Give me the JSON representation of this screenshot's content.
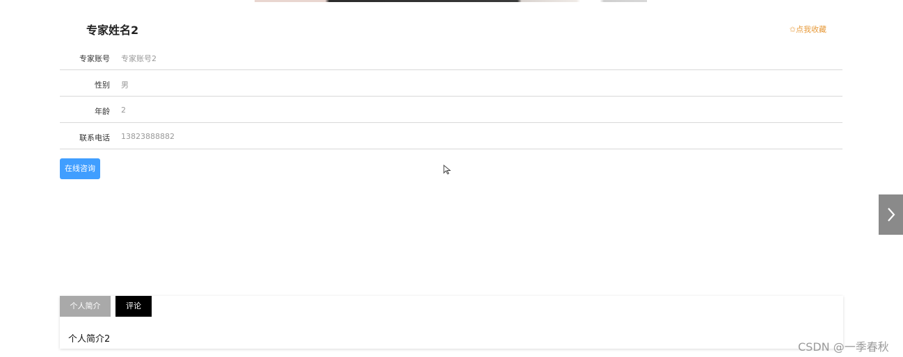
{
  "expert": {
    "name": "专家姓名2",
    "favorite_label": "✩点我收藏",
    "fields": [
      {
        "label": "专家账号",
        "value": "专家账号2"
      },
      {
        "label": "性别",
        "value": "男"
      },
      {
        "label": "年龄",
        "value": "2"
      },
      {
        "label": "联系电话",
        "value": "13823888882"
      }
    ],
    "consult_button": "在线咨询"
  },
  "tabs": [
    {
      "label": "个人简介",
      "active": false
    },
    {
      "label": "评论",
      "active": true
    }
  ],
  "intro_content": "个人简介2",
  "watermark": "CSDN @一季春秋",
  "colors": {
    "primary_button": "#409eff",
    "favorite": "#e79a3a",
    "tab_inactive": "#a9a9a9",
    "tab_active": "#000000",
    "carousel_arrow": "#8a8a8a"
  },
  "icons": {
    "carousel_next": "chevron-right-icon",
    "pointer": "mouse-cursor-icon"
  }
}
